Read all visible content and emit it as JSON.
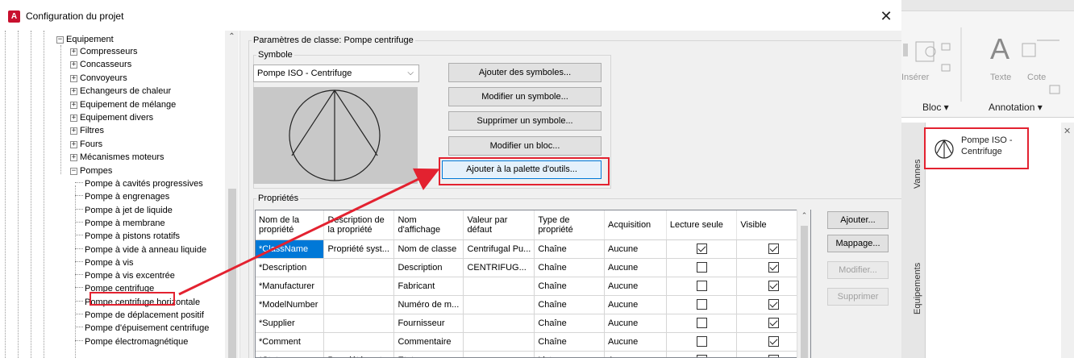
{
  "dialog": {
    "app_icon": "A",
    "title": "Configuration du projet",
    "close_glyph": "✕"
  },
  "tree": {
    "root": "Equipement",
    "groups": [
      "Compresseurs",
      "Concasseurs",
      "Convoyeurs",
      "Echangeurs de chaleur",
      "Equipement de mélange",
      "Equipement divers",
      "Filtres",
      "Fours",
      "Mécanismes moteurs"
    ],
    "open_group": "Pompes",
    "pumps": [
      "Pompe à cavités progressives",
      "Pompe à engrenages",
      "Pompe à jet de liquide",
      "Pompe à membrane",
      "Pompe à pistons rotatifs",
      "Pompe à vide à anneau liquide",
      "Pompe à vis",
      "Pompe à vis excentrée",
      "Pompe centrifuge",
      "Pompe centrifuge horizontale",
      "Pompe de déplacement positif",
      "Pompe d'épuisement centrifuge",
      "Pompe électromagnétique"
    ],
    "selected": "Pompe centrifuge"
  },
  "class_params": {
    "label": "Paramètres de classe: Pompe centrifuge",
    "symbol_group": "Symbole",
    "symbol_selected": "Pompe ISO - Centrifuge",
    "buttons": {
      "add_symbols": "Ajouter des symboles...",
      "edit_symbol": "Modifier un symbole...",
      "delete_symbol": "Supprimer un symbole...",
      "edit_block": "Modifier un bloc...",
      "add_palette": "Ajouter à la palette d'outils..."
    }
  },
  "properties": {
    "label": "Propriétés",
    "headers": [
      "Nom de la propriété",
      "Description de la propriété",
      "Nom d'affichage",
      "Valeur par défaut",
      "Type de propriété",
      "Acquisition",
      "Lecture seule",
      "Visible"
    ],
    "rows": [
      {
        "name": "*ClassName",
        "desc": "Propriété syst...",
        "display": "Nom de classe",
        "default": "Centrifugal Pu...",
        "type": "Chaîne",
        "acq": "Aucune",
        "ro": true,
        "vis": true
      },
      {
        "name": "*Description",
        "desc": "",
        "display": "Description",
        "default": "CENTRIFUG...",
        "type": "Chaîne",
        "acq": "Aucune",
        "ro": false,
        "vis": true
      },
      {
        "name": "*Manufacturer",
        "desc": "",
        "display": "Fabricant",
        "default": "",
        "type": "Chaîne",
        "acq": "Aucune",
        "ro": false,
        "vis": true
      },
      {
        "name": "*ModelNumber",
        "desc": "",
        "display": "Numéro de m...",
        "default": "",
        "type": "Chaîne",
        "acq": "Aucune",
        "ro": false,
        "vis": true
      },
      {
        "name": "*Supplier",
        "desc": "",
        "display": "Fournisseur",
        "default": "",
        "type": "Chaîne",
        "acq": "Aucune",
        "ro": false,
        "vis": true
      },
      {
        "name": "*Comment",
        "desc": "",
        "display": "Commentaire",
        "default": "",
        "type": "Chaîne",
        "acq": "Aucune",
        "ro": false,
        "vis": true
      },
      {
        "name": "*Status",
        "desc": "Propriété syst...",
        "display": "Etat",
        "default": "",
        "type": "Liste",
        "acq": "Aucune",
        "ro": false,
        "vis": true
      }
    ],
    "side_buttons": {
      "add": "Ajouter...",
      "mapping": "Mappage...",
      "modify": "Modifier...",
      "delete": "Supprimer"
    }
  },
  "autocad": {
    "insert_label": "Insérer",
    "text_glyph": "A",
    "text_label": "Texte",
    "dim_label": "Cote",
    "panel_bloc": "Bloc ▾",
    "panel_annotation": "Annotation ▾",
    "tab_vannes": "Vannes",
    "tab_equipements": "Equipements",
    "palette_item": "Pompe ISO - Centrifuge"
  }
}
